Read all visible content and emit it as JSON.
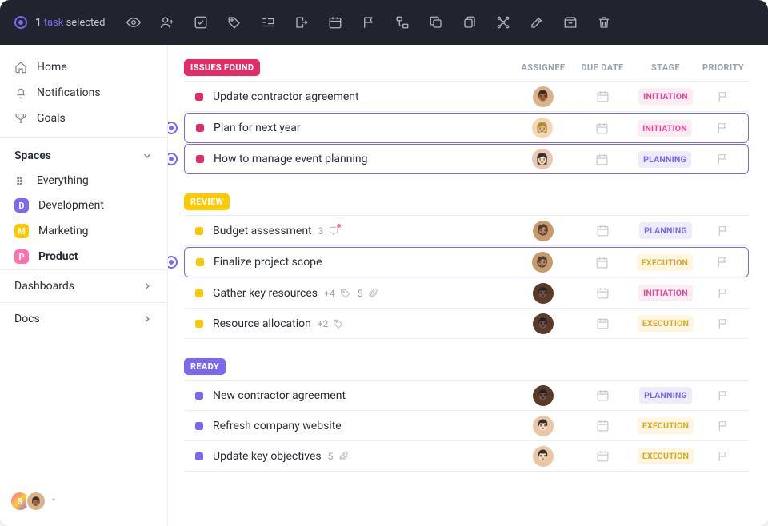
{
  "selection": {
    "count": "1",
    "word_task": "task",
    "word_selected": "selected"
  },
  "sidebar": {
    "nav": [
      {
        "label": "Home",
        "icon": "home"
      },
      {
        "label": "Notifications",
        "icon": "bell"
      },
      {
        "label": "Goals",
        "icon": "trophy"
      }
    ],
    "spaces_header": "Spaces",
    "everything_label": "Everything",
    "spaces": [
      {
        "letter": "D",
        "label": "Development",
        "color": "#7B68EE"
      },
      {
        "letter": "M",
        "label": "Marketing",
        "color": "#FFC800"
      },
      {
        "letter": "P",
        "label": "Product",
        "color": "#FD71AF",
        "active": true
      }
    ],
    "sections": [
      {
        "label": "Dashboards"
      },
      {
        "label": "Docs"
      }
    ],
    "footer": {
      "initial": "S"
    }
  },
  "columns": {
    "assignee": "ASSIGNEE",
    "due": "DUE DATE",
    "stage": "STAGE",
    "priority": "PRIORITY"
  },
  "groups": [
    {
      "id": "issues_found",
      "label": "ISSUES FOUND",
      "pill_bg": "#E32C66",
      "square": "#E32C66",
      "tasks": [
        {
          "title": "Update contractor agreement",
          "stage": "INITIATION",
          "stage_class": "stage-initiation",
          "avatar_bg": "#D9B38C",
          "emoji": "👨🏾"
        },
        {
          "title": "Plan for next year",
          "stage": "INITIATION",
          "stage_class": "stage-initiation",
          "avatar_bg": "#F4D8B5",
          "emoji": "👩🏼",
          "selected": true
        },
        {
          "title": "How to manage event planning",
          "stage": "PLANNING",
          "stage_class": "stage-planning",
          "avatar_bg": "#E8C8B0",
          "emoji": "👩🏻",
          "selected": true
        }
      ]
    },
    {
      "id": "review",
      "label": "REVIEW",
      "pill_bg": "#FFC800",
      "square": "#FFC800",
      "tasks": [
        {
          "title": "Budget assessment",
          "stage": "PLANNING",
          "stage_class": "stage-planning",
          "avatar_bg": "#C79A6B",
          "emoji": "🧔🏽",
          "meta": [
            {
              "text": "3",
              "icon": "chat",
              "dot": true
            }
          ]
        },
        {
          "title": "Finalize project scope",
          "stage": "EXECUTION",
          "stage_class": "stage-execution",
          "avatar_bg": "#C79A6B",
          "emoji": "🧔🏽",
          "selected": true
        },
        {
          "title": "Gather key resources",
          "stage": "INITIATION",
          "stage_class": "stage-initiation",
          "avatar_bg": "#5B3A29",
          "emoji": "👨🏿",
          "meta": [
            {
              "text": "+4",
              "icon": "tag"
            },
            {
              "text": "5",
              "icon": "clip"
            }
          ]
        },
        {
          "title": "Resource allocation",
          "stage": "EXECUTION",
          "stage_class": "stage-execution",
          "avatar_bg": "#5B3A29",
          "emoji": "👨🏿",
          "meta": [
            {
              "text": "+2",
              "icon": "tag"
            }
          ]
        }
      ]
    },
    {
      "id": "ready",
      "label": "READY",
      "pill_bg": "#7B68EE",
      "square": "#7B68EE",
      "tasks": [
        {
          "title": "New contractor agreement",
          "stage": "PLANNING",
          "stage_class": "stage-planning",
          "avatar_bg": "#5B3A29",
          "emoji": "👨🏿"
        },
        {
          "title": "Refresh company website",
          "stage": "EXECUTION",
          "stage_class": "stage-execution",
          "avatar_bg": "#E9C6A5",
          "emoji": "👨🏻"
        },
        {
          "title": "Update key objectives",
          "stage": "EXECUTION",
          "stage_class": "stage-execution",
          "avatar_bg": "#E9C6A5",
          "emoji": "👨🏻",
          "meta": [
            {
              "text": "5",
              "icon": "clip"
            }
          ]
        }
      ]
    }
  ],
  "toolbar_icons": [
    "eye",
    "user-plus",
    "checklist",
    "tag",
    "indent",
    "move-out",
    "calendar",
    "flag",
    "subtask",
    "copy",
    "duplicate",
    "dependency",
    "edit",
    "archive",
    "trash"
  ]
}
